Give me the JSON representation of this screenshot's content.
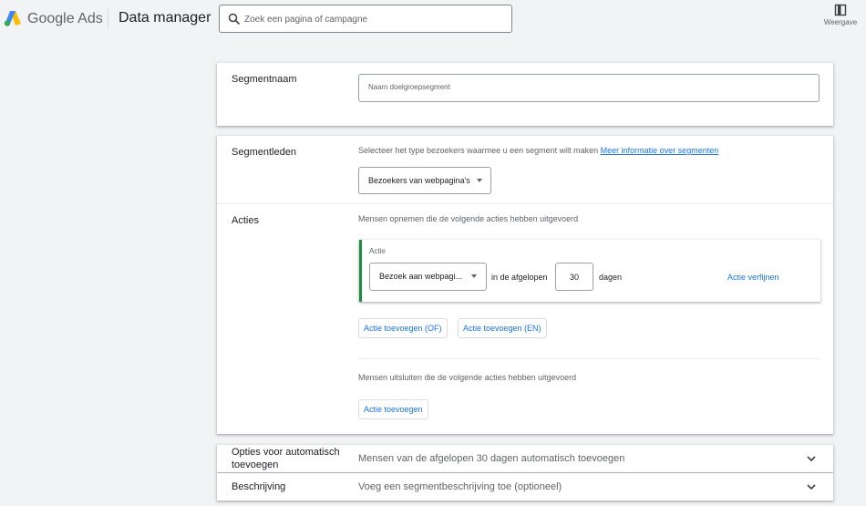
{
  "header": {
    "brand": "Google Ads",
    "product": "Data manager",
    "search_placeholder": "Zoek een pagina of campagne",
    "view_label": "Weergave"
  },
  "segment_name": {
    "label": "Segmentnaam",
    "placeholder": "Naam doelgroepsegment"
  },
  "segment_members": {
    "label": "Segmentleden",
    "description": "Selecteer het type bezoekers waarmee u een segment wilt maken",
    "info_link": "Meer informatie over segmenten",
    "visitor_type": "Bezoekers van webpagina's"
  },
  "actions": {
    "label": "Acties",
    "include_text": "Mensen opnemen die de volgende acties hebben uitgevoerd",
    "action_title": "Actie",
    "action_type": "Bezoek aan webpagi...",
    "in_last_label": "in de afgelopen",
    "days_value": "30",
    "days_label": "dagen",
    "refine_label": "Actie verfijnen",
    "add_or": "Actie toevoegen (OF)",
    "add_and": "Actie toevoegen (EN)",
    "exclude_text": "Mensen uitsluiten die de volgende acties hebben uitgevoerd",
    "add_exclude": "Actie toevoegen"
  },
  "auto_add": {
    "label_line1": "Opties voor automatisch",
    "label_line2": "toevoegen",
    "text": "Mensen van de afgelopen 30 dagen automatisch toevoegen"
  },
  "description": {
    "label": "Beschrijving",
    "text": "Voeg een segmentbeschrijving toe (optioneel)"
  },
  "colors": {
    "accent": "#1a73e8",
    "action_border": "#1e8e3e",
    "background": "#f1f3f4"
  }
}
